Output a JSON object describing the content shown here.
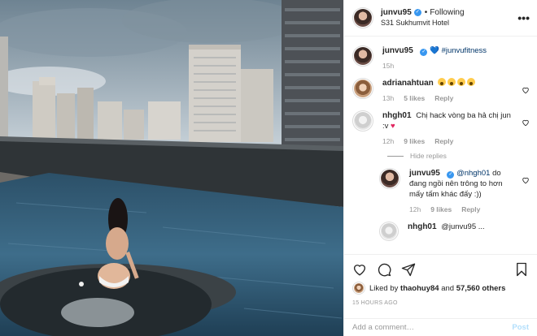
{
  "header": {
    "username": "junvu95",
    "follow_separator": "•",
    "follow_label": "Following",
    "location": "S31 Sukhumvit Hotel",
    "more_label": "•••"
  },
  "caption": {
    "username": "junvu95",
    "heart_emoji": "💙",
    "hashtag": "#junvufitness",
    "time": "15h"
  },
  "comments": [
    {
      "username": "adrianahtuan",
      "time": "13h",
      "likes": "5 likes",
      "reply_label": "Reply"
    },
    {
      "username": "nhgh01",
      "text": "Chị hack vòng ba hả chị jun :v",
      "heart_emoji": "♥",
      "time": "12h",
      "likes": "9 likes",
      "reply_label": "Reply"
    }
  ],
  "hide_replies_label": "Hide replies",
  "reply": {
    "username": "junvu95",
    "mention": "@nhgh01",
    "text": "do đang ngồi nên trông to hơn mấy tấm khác đấy :))",
    "time": "12h",
    "likes": "9 likes",
    "reply_label": "Reply"
  },
  "partial_comment": {
    "username": "nhgh01",
    "text": "@junvu95 ..."
  },
  "likes_line": {
    "prefix": "Liked by",
    "user": "thaohuy84",
    "conj": "and",
    "count": "57,560 others"
  },
  "timestamp": "15 HOURS AGO",
  "add_comment": {
    "placeholder": "Add a comment…",
    "post_label": "Post"
  },
  "colors": {
    "link_blue": "#3897f0",
    "post_disabled": "#b2dffc",
    "meta_gray": "#999999"
  },
  "icons": [
    "heart-icon",
    "comment-icon",
    "share-icon",
    "bookmark-icon",
    "verified-icon",
    "more-icon"
  ]
}
